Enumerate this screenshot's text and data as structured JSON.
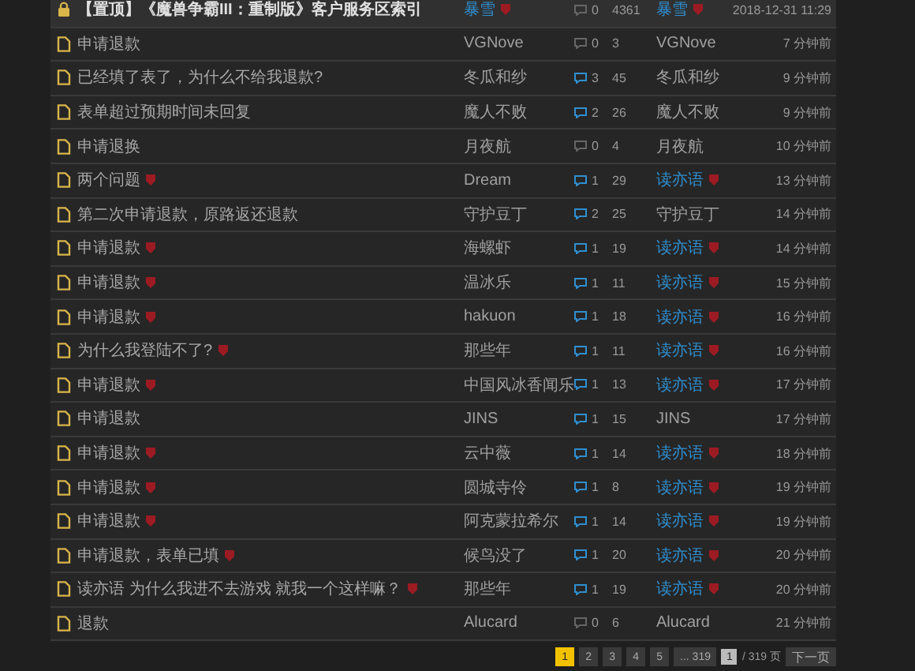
{
  "threads": [
    {
      "kind": "pinned",
      "title": "【置顶】《魔兽争霸III：重制版》客户服务区索引",
      "title_badge": false,
      "author": {
        "name": "暴雪",
        "staff": true
      },
      "replies": "0",
      "has_replies": false,
      "views": "4361",
      "last_poster": {
        "name": "暴雪",
        "staff": true
      },
      "time": "2018-12-31 11:29"
    },
    {
      "kind": "normal",
      "title": "申请退款",
      "title_badge": false,
      "author": {
        "name": "VGNove",
        "staff": false
      },
      "replies": "0",
      "has_replies": false,
      "views": "3",
      "last_poster": {
        "name": "VGNove",
        "staff": false
      },
      "time": "7 分钟前"
    },
    {
      "kind": "normal",
      "title": "已经填了表了，为什么不给我退款?",
      "title_badge": false,
      "author": {
        "name": "冬瓜和纱",
        "staff": false
      },
      "replies": "3",
      "has_replies": true,
      "views": "45",
      "last_poster": {
        "name": "冬瓜和纱",
        "staff": false
      },
      "time": "9 分钟前"
    },
    {
      "kind": "normal",
      "title": "表单超过预期时间未回复",
      "title_badge": false,
      "author": {
        "name": "魔人不败",
        "staff": false
      },
      "replies": "2",
      "has_replies": true,
      "views": "26",
      "last_poster": {
        "name": "魔人不败",
        "staff": false
      },
      "time": "9 分钟前"
    },
    {
      "kind": "normal",
      "title": "申请退换",
      "title_badge": false,
      "author": {
        "name": "月夜航",
        "staff": false
      },
      "replies": "0",
      "has_replies": false,
      "views": "4",
      "last_poster": {
        "name": "月夜航",
        "staff": false
      },
      "time": "10 分钟前"
    },
    {
      "kind": "normal",
      "title": "两个问题",
      "title_badge": true,
      "author": {
        "name": "Dream",
        "staff": false
      },
      "replies": "1",
      "has_replies": true,
      "views": "29",
      "last_poster": {
        "name": "读亦语",
        "staff": true
      },
      "time": "13 分钟前"
    },
    {
      "kind": "normal",
      "title": "第二次申请退款，原路返还退款",
      "title_badge": false,
      "author": {
        "name": "守护豆丁",
        "staff": false
      },
      "replies": "2",
      "has_replies": true,
      "views": "25",
      "last_poster": {
        "name": "守护豆丁",
        "staff": false
      },
      "time": "14 分钟前"
    },
    {
      "kind": "normal",
      "title": "申请退款",
      "title_badge": true,
      "author": {
        "name": "海螺虾",
        "staff": false
      },
      "replies": "1",
      "has_replies": true,
      "views": "19",
      "last_poster": {
        "name": "读亦语",
        "staff": true
      },
      "time": "14 分钟前"
    },
    {
      "kind": "normal",
      "title": "申请退款",
      "title_badge": true,
      "author": {
        "name": "温冰乐",
        "staff": false
      },
      "replies": "1",
      "has_replies": true,
      "views": "11",
      "last_poster": {
        "name": "读亦语",
        "staff": true
      },
      "time": "15 分钟前"
    },
    {
      "kind": "normal",
      "title": "申请退款",
      "title_badge": true,
      "author": {
        "name": "hakuon",
        "staff": false
      },
      "replies": "1",
      "has_replies": true,
      "views": "18",
      "last_poster": {
        "name": "读亦语",
        "staff": true
      },
      "time": "16 分钟前"
    },
    {
      "kind": "normal",
      "title": "为什么我登陆不了?",
      "title_badge": true,
      "author": {
        "name": "那些年",
        "staff": false
      },
      "replies": "1",
      "has_replies": true,
      "views": "11",
      "last_poster": {
        "name": "读亦语",
        "staff": true
      },
      "time": "16 分钟前"
    },
    {
      "kind": "normal",
      "title": "申请退款",
      "title_badge": true,
      "author": {
        "name": "中国风冰香闻乐",
        "staff": false
      },
      "replies": "1",
      "has_replies": true,
      "views": "13",
      "last_poster": {
        "name": "读亦语",
        "staff": true
      },
      "time": "17 分钟前"
    },
    {
      "kind": "normal",
      "title": "申请退款",
      "title_badge": false,
      "author": {
        "name": "JINS",
        "staff": false
      },
      "replies": "1",
      "has_replies": true,
      "views": "15",
      "last_poster": {
        "name": "JINS",
        "staff": false
      },
      "time": "17 分钟前"
    },
    {
      "kind": "normal",
      "title": "申请退款",
      "title_badge": true,
      "author": {
        "name": "云中薇",
        "staff": false
      },
      "replies": "1",
      "has_replies": true,
      "views": "14",
      "last_poster": {
        "name": "读亦语",
        "staff": true
      },
      "time": "18 分钟前"
    },
    {
      "kind": "normal",
      "title": "申请退款",
      "title_badge": true,
      "author": {
        "name": "圆城寺伶",
        "staff": false
      },
      "replies": "1",
      "has_replies": true,
      "views": "8",
      "last_poster": {
        "name": "读亦语",
        "staff": true
      },
      "time": "19 分钟前"
    },
    {
      "kind": "normal",
      "title": "申请退款",
      "title_badge": true,
      "author": {
        "name": "阿克蒙拉希尔",
        "staff": false
      },
      "replies": "1",
      "has_replies": true,
      "views": "14",
      "last_poster": {
        "name": "读亦语",
        "staff": true
      },
      "time": "19 分钟前"
    },
    {
      "kind": "normal",
      "title": "申请退款，表单已填",
      "title_badge": true,
      "author": {
        "name": "候鸟没了",
        "staff": false
      },
      "replies": "1",
      "has_replies": true,
      "views": "20",
      "last_poster": {
        "name": "读亦语",
        "staff": true
      },
      "time": "20 分钟前"
    },
    {
      "kind": "normal",
      "title": "读亦语 为什么我进不去游戏 就我一个这样嘛？",
      "title_badge": true,
      "author": {
        "name": "那些年",
        "staff": false
      },
      "replies": "1",
      "has_replies": true,
      "views": "19",
      "last_poster": {
        "name": "读亦语",
        "staff": true
      },
      "time": "20 分钟前"
    },
    {
      "kind": "normal",
      "title": "退款",
      "title_badge": false,
      "author": {
        "name": "Alucard",
        "staff": false
      },
      "replies": "0",
      "has_replies": false,
      "views": "6",
      "last_poster": {
        "name": "Alucard",
        "staff": false
      },
      "time": "21 分钟前"
    }
  ],
  "pagination": {
    "pages": [
      {
        "label": "1",
        "selected": true
      },
      {
        "label": "2",
        "selected": false
      },
      {
        "label": "3",
        "selected": false
      },
      {
        "label": "4",
        "selected": false
      },
      {
        "label": "5",
        "selected": false
      },
      {
        "label": "... 319",
        "selected": false
      }
    ],
    "page_input": "1",
    "total": "/ 319 页",
    "next": "下一页"
  }
}
